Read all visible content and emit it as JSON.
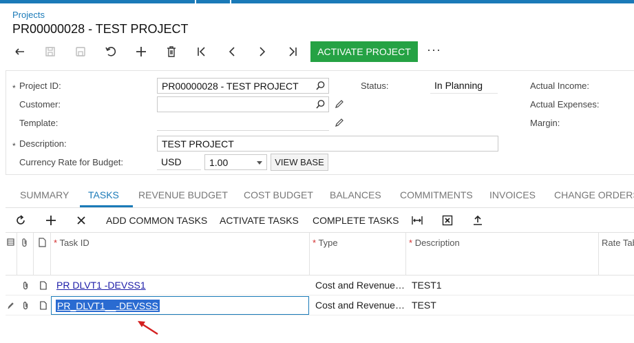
{
  "breadcrumb": "Projects",
  "title": "PR00000028 - TEST PROJECT",
  "toolbar": {
    "buttons": [
      "back-icon",
      "save-icon",
      "save-close-icon",
      "undo-icon",
      "add-icon",
      "delete-icon",
      "first-icon",
      "prev-icon",
      "next-icon",
      "last-icon"
    ],
    "activate_label": "ACTIVATE PROJECT",
    "more_label": "···"
  },
  "form": {
    "project_id_label": "Project ID:",
    "project_id_value": "PR00000028 - TEST PROJECT",
    "customer_label": "Customer:",
    "customer_value": "",
    "template_label": "Template:",
    "template_value": "",
    "description_label": "Description:",
    "description_value": "TEST PROJECT",
    "currency_label": "Currency Rate for Budget:",
    "currency_value": "USD",
    "rate_value": "1.00",
    "view_base_label": "VIEW BASE",
    "status_label": "Status:",
    "status_value": "In Planning",
    "actual_income_label": "Actual Income:",
    "actual_expenses_label": "Actual Expenses:",
    "margin_label": "Margin:",
    "required_mark": "*"
  },
  "tabs": [
    "SUMMARY",
    "TASKS",
    "REVENUE BUDGET",
    "COST BUDGET",
    "BALANCES",
    "COMMITMENTS",
    "INVOICES",
    "CHANGE ORDERS"
  ],
  "active_tab": "TASKS",
  "grid_toolbar": {
    "add_common_tasks": "ADD COMMON TASKS",
    "activate_tasks": "ACTIVATE TASKS",
    "complete_tasks": "COMPLETE TASKS"
  },
  "grid": {
    "columns": {
      "task_id": "Task ID",
      "type": "Type",
      "description": "Description",
      "rate_table": "Rate Tab"
    },
    "rows": [
      {
        "task_id": "PR DLVT1 -DEVSS1",
        "type": "Cost and Revenue…",
        "description": "TEST1"
      },
      {
        "task_id": "PR_DLVT1__-DEVSSS",
        "type": "Cost and Revenue…",
        "description": "TEST"
      }
    ]
  },
  "colors": {
    "accent": "#1a7ab8",
    "activate": "#25a244",
    "annotation_arrow": "#d42020",
    "link": "#1c1ca8"
  }
}
